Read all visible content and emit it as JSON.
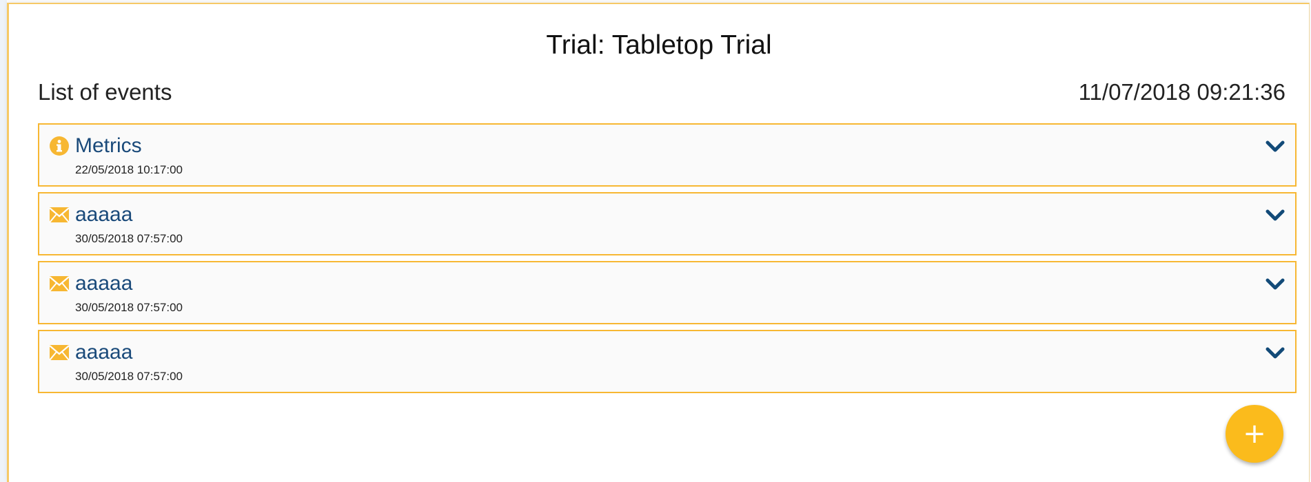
{
  "page": {
    "title": "Trial: Tabletop Trial"
  },
  "list": {
    "title": "List of events",
    "current_time": "11/07/2018 09:21:36"
  },
  "events": [
    {
      "icon": "info-icon",
      "name": "Metrics",
      "time": "22/05/2018 10:17:00"
    },
    {
      "icon": "envelope-icon",
      "name": "aaaaa",
      "time": "30/05/2018 07:57:00"
    },
    {
      "icon": "envelope-icon",
      "name": "aaaaa",
      "time": "30/05/2018 07:57:00"
    },
    {
      "icon": "envelope-icon",
      "name": "aaaaa",
      "time": "30/05/2018 07:57:00"
    }
  ],
  "fab": {
    "label": "+",
    "icon": "plus-icon"
  },
  "colors": {
    "accent": "#fbbb1c",
    "border": "#f7b732",
    "event_title": "#1a4a7a",
    "chevron": "#124a78"
  }
}
